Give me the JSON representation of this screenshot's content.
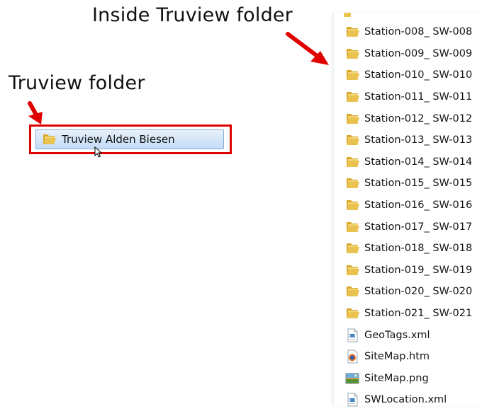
{
  "callouts": {
    "inside": "Inside Truview folder",
    "truview": "Truview folder"
  },
  "selected_folder": {
    "label": "Truview Alden Biesen",
    "icon": "folder-icon"
  },
  "files": [
    {
      "label": "Station-008_ SW-008",
      "icon": "folder"
    },
    {
      "label": "Station-009_ SW-009",
      "icon": "folder"
    },
    {
      "label": "Station-010_ SW-010",
      "icon": "folder"
    },
    {
      "label": "Station-011_ SW-011",
      "icon": "folder"
    },
    {
      "label": "Station-012_ SW-012",
      "icon": "folder"
    },
    {
      "label": "Station-013_ SW-013",
      "icon": "folder"
    },
    {
      "label": "Station-014_ SW-014",
      "icon": "folder"
    },
    {
      "label": "Station-015_ SW-015",
      "icon": "folder"
    },
    {
      "label": "Station-016_ SW-016",
      "icon": "folder"
    },
    {
      "label": "Station-017_ SW-017",
      "icon": "folder"
    },
    {
      "label": "Station-018_ SW-018",
      "icon": "folder"
    },
    {
      "label": "Station-019_ SW-019",
      "icon": "folder"
    },
    {
      "label": "Station-020_ SW-020",
      "icon": "folder"
    },
    {
      "label": "Station-021_ SW-021",
      "icon": "folder"
    },
    {
      "label": "GeoTags.xml",
      "icon": "xml-file"
    },
    {
      "label": "SiteMap.htm",
      "icon": "htm-file"
    },
    {
      "label": "SiteMap.png",
      "icon": "png-file"
    },
    {
      "label": "SWLocation.xml",
      "icon": "xml-file"
    }
  ],
  "colors": {
    "highlight_border": "#e00000",
    "arrow": "#e00000",
    "folder": "#e8c64e",
    "selection": "#c4dcf6"
  }
}
